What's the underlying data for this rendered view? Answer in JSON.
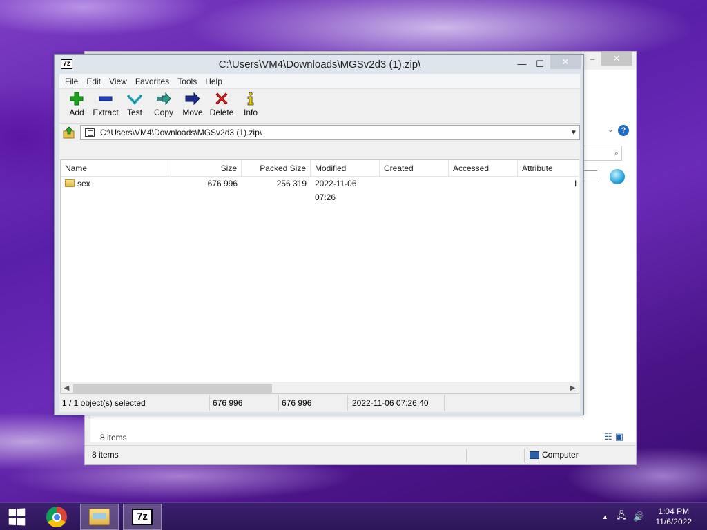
{
  "sevenzip": {
    "title": "C:\\Users\\VM4\\Downloads\\MGSv2d3 (1).zip\\",
    "app_icon_text": "7z",
    "menu": [
      "File",
      "Edit",
      "View",
      "Favorites",
      "Tools",
      "Help"
    ],
    "toolbar": [
      {
        "label": "Add",
        "icon": "add-icon"
      },
      {
        "label": "Extract",
        "icon": "extract-icon"
      },
      {
        "label": "Test",
        "icon": "test-icon"
      },
      {
        "label": "Copy",
        "icon": "copy-icon"
      },
      {
        "label": "Move",
        "icon": "move-icon"
      },
      {
        "label": "Delete",
        "icon": "delete-icon"
      },
      {
        "label": "Info",
        "icon": "info-icon"
      }
    ],
    "address": "C:\\Users\\VM4\\Downloads\\MGSv2d3 (1).zip\\",
    "columns": [
      "Name",
      "Size",
      "Packed Size",
      "Modified",
      "Created",
      "Accessed",
      "Attribute"
    ],
    "rows": [
      {
        "name": "sex",
        "size": "676 996",
        "packed": "256 319",
        "modified": "2022-11-06 07:26",
        "created": "",
        "accessed": "",
        "attributes": "I"
      }
    ],
    "status": {
      "selected": "1 / 1 object(s) selected",
      "size": "676 996",
      "packed": "676 996",
      "modified": "2022-11-06 07:26:40"
    }
  },
  "explorer": {
    "items_count_main": "8 items",
    "items_count_status": "8 items",
    "location": "Computer"
  },
  "taskbar": {
    "apps": [
      "chrome-icon",
      "file-explorer-icon",
      "7zip-icon"
    ],
    "sevenzip_task_text": "7z",
    "time": "1:04 PM",
    "date": "11/6/2022"
  },
  "colors": {
    "taskbar": "#2c1658",
    "add_green": "#1aa31a",
    "extract_blue": "#1e3fb5",
    "test_cyan": "#38b8c8",
    "delete_red": "#d11a1a",
    "info_yellow": "#e7d000"
  }
}
